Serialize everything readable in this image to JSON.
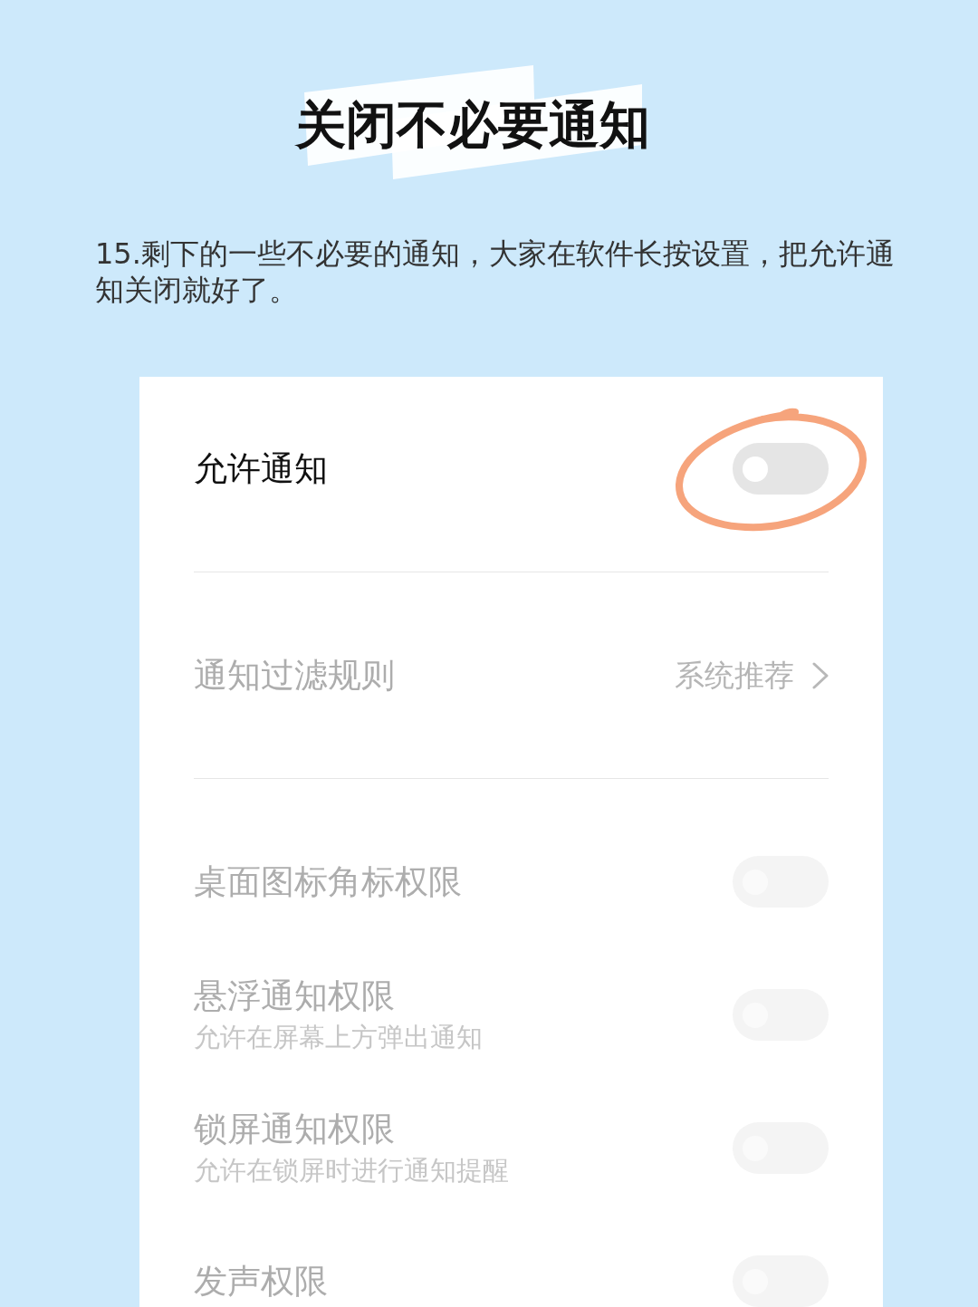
{
  "title": {
    "text": "关闭不必要通知",
    "brush_highlight": true
  },
  "paragraph": "15.剩下的一些不必要的通知，大家在软件长按设置，把允许通知关闭就好了。",
  "sections": [
    {
      "items": [
        {
          "kind": "toggle",
          "label": "允许通知",
          "disabled": false,
          "on": false,
          "circled": true
        }
      ]
    },
    {
      "items": [
        {
          "kind": "link",
          "label": "通知过滤规则",
          "value": "系统推荐",
          "disabled": true
        }
      ]
    },
    {
      "items": [
        {
          "kind": "toggle",
          "label": "桌面图标角标权限",
          "disabled": true,
          "on": false
        },
        {
          "kind": "toggle",
          "label": "悬浮通知权限",
          "description": "允许在屏幕上方弹出通知",
          "disabled": true,
          "on": false
        },
        {
          "kind": "toggle",
          "label": "锁屏通知权限",
          "description": "允许在锁屏时进行通知提醒",
          "disabled": true,
          "on": false
        },
        {
          "kind": "toggle",
          "label": "发声权限",
          "disabled": true,
          "on": false
        }
      ]
    }
  ]
}
